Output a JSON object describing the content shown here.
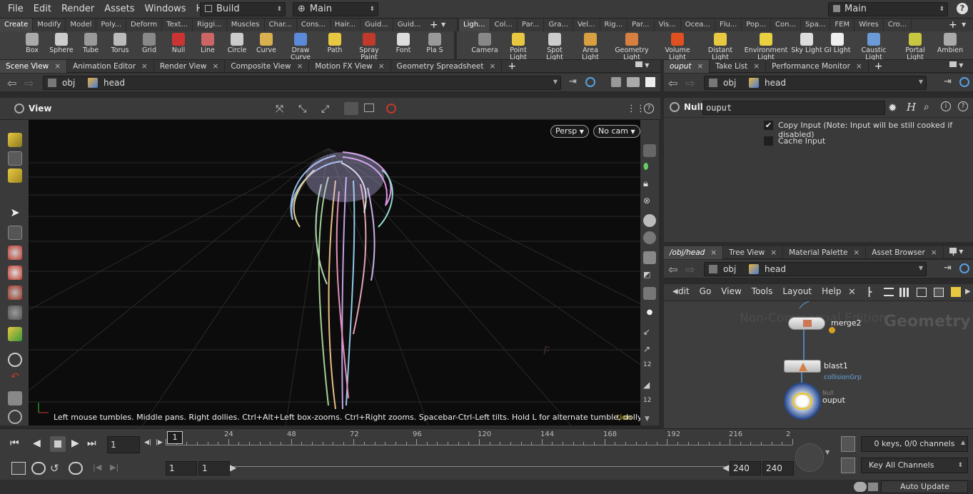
{
  "menu": [
    "File",
    "Edit",
    "Render",
    "Assets",
    "Windows",
    "Help"
  ],
  "desktop": "Build",
  "context": "Main",
  "right_desktop": "Main",
  "shelf_tabs_left": [
    "Create",
    "Modify",
    "Model",
    "Poly...",
    "Deform",
    "Text...",
    "Riggi...",
    "Muscles",
    "Char...",
    "Cons...",
    "Hair...",
    "Guid...",
    "Guid..."
  ],
  "shelf_tabs_right": [
    "Ligh...",
    "Col...",
    "Par...",
    "Gra...",
    "Vel...",
    "Rig...",
    "Par...",
    "Vis...",
    "Ocea...",
    "Flu...",
    "Pop...",
    "Con...",
    "Spa...",
    "FEM",
    "Wires",
    "Cro..."
  ],
  "tools_left": [
    "Box",
    "Sphere",
    "Tube",
    "Torus",
    "Grid",
    "Null",
    "Line",
    "Circle",
    "Curve",
    "Draw Curve",
    "Path",
    "Spray Paint",
    "Font",
    "Pla S"
  ],
  "tools_right": [
    "Camera",
    "Point Light",
    "Spot Light",
    "Area Light",
    "Geometry Light",
    "Volume Light",
    "Distant Light",
    "Environment Light",
    "Sky Light",
    "GI Light",
    "Caustic Light",
    "Portal Light",
    "Ambien"
  ],
  "pane_tabs_left": [
    "Scene View",
    "Animation Editor",
    "Render View",
    "Composite View",
    "Motion FX View",
    "Geometry Spreadsheet"
  ],
  "pane_tabs_right_top": [
    "ouput",
    "Take List",
    "Performance Monitor"
  ],
  "pane_tabs_right_bottom": [
    "/obj/head",
    "Tree View",
    "Material Palette",
    "Asset Browser"
  ],
  "path": {
    "obj": "obj",
    "node": "head"
  },
  "view_label": "View",
  "persp": "Persp",
  "cam": "No cam",
  "hint": "Left mouse tumbles. Middle pans. Right dollies. Ctrl+Alt+Left box-zooms. Ctrl+Right zooms. Spacebar-Ctrl-Left tilts. Hold L for alternate tumble, dolly, and zoom.",
  "hint_tail": "tion",
  "params": {
    "node_type": "Null",
    "node_name": "ouput",
    "copy_input": "Copy Input (Note: Input will be still cooked if disabled)",
    "cache_input": "Cache Input"
  },
  "network_menu": [
    "dit",
    "Go",
    "View",
    "Tools",
    "Layout",
    "Help"
  ],
  "network": {
    "watermark": "Non-Commercial Edition",
    "context_label": "Geometry",
    "nodes": [
      {
        "name": "merge2",
        "sub": ""
      },
      {
        "name": "blast1",
        "sub": "collisionGrp"
      },
      {
        "name": "ouput",
        "sub": "Null"
      }
    ]
  },
  "timeline": {
    "frame": "1",
    "ticks": [
      "24",
      "48",
      "72",
      "96",
      "120",
      "144",
      "168",
      "192",
      "216",
      "2"
    ],
    "current_marker": "1",
    "start": "1",
    "start2": "1",
    "end": "240",
    "end2": "240",
    "keys": "0 keys, 0/0 channels",
    "key_all": "Key All Channels",
    "auto_update": "Auto Update"
  }
}
